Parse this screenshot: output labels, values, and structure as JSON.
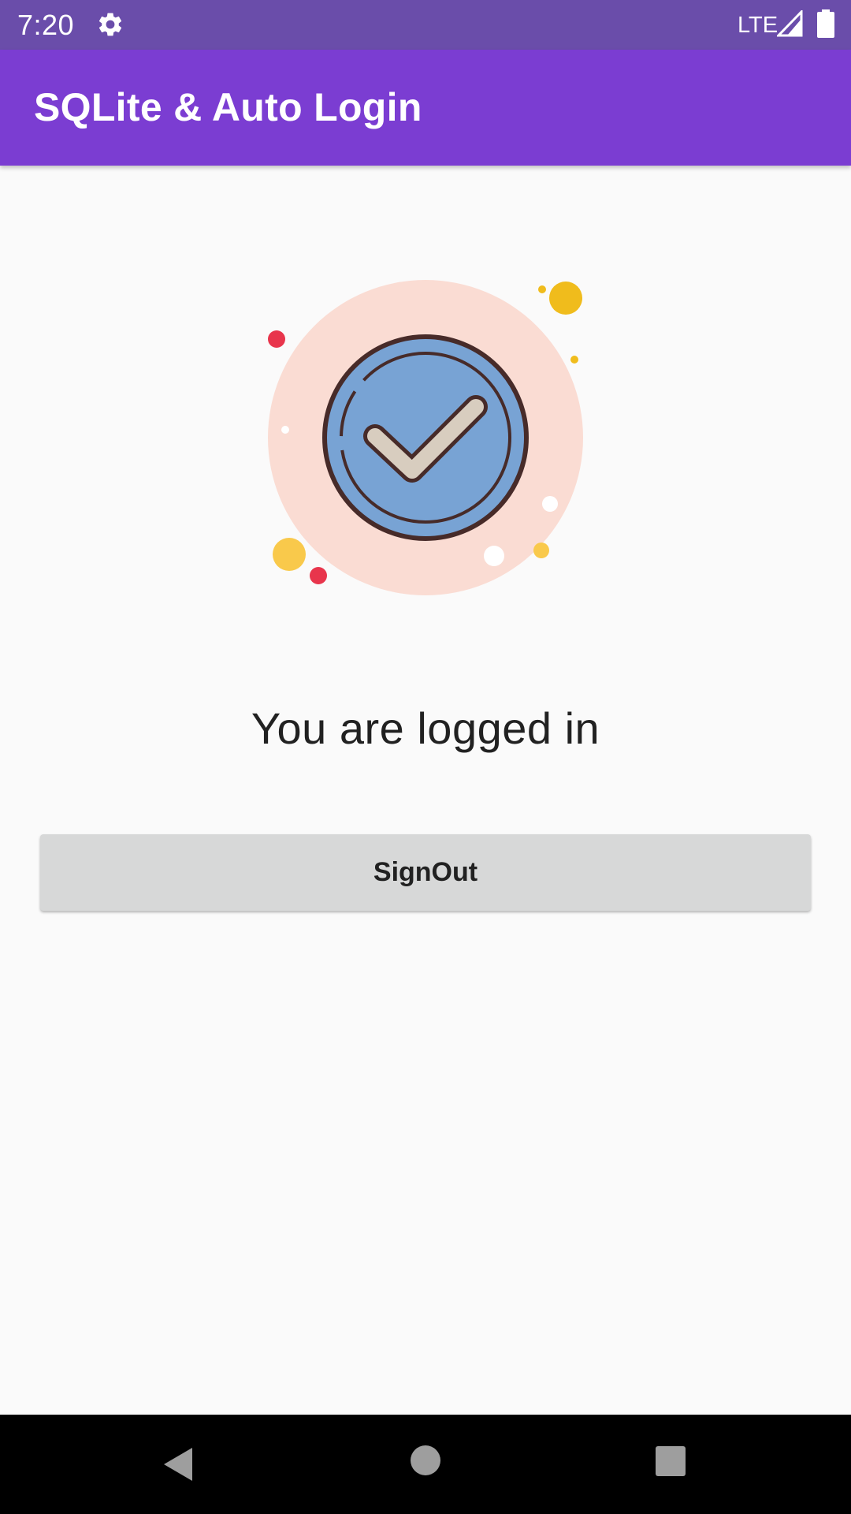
{
  "status_bar": {
    "time": "7:20",
    "network": "LTE",
    "icons": [
      "gear-icon",
      "signal-icon",
      "battery-icon"
    ]
  },
  "app_bar": {
    "title": "SQLite & Auto Login"
  },
  "main": {
    "illustration_icon": "check-circle-icon",
    "message": "You are logged in",
    "signout_label": "SignOut"
  },
  "nav_bar": {
    "icons": [
      "back-icon",
      "home-icon",
      "recents-icon"
    ]
  },
  "colors": {
    "status_bar": "#6a4daa",
    "app_bar": "#7b3dd2",
    "background": "#fafafa",
    "button": "#d7d8d8",
    "halo": "#fadcd3",
    "badge_fill": "#78a3d4",
    "badge_outline": "#472b29"
  }
}
